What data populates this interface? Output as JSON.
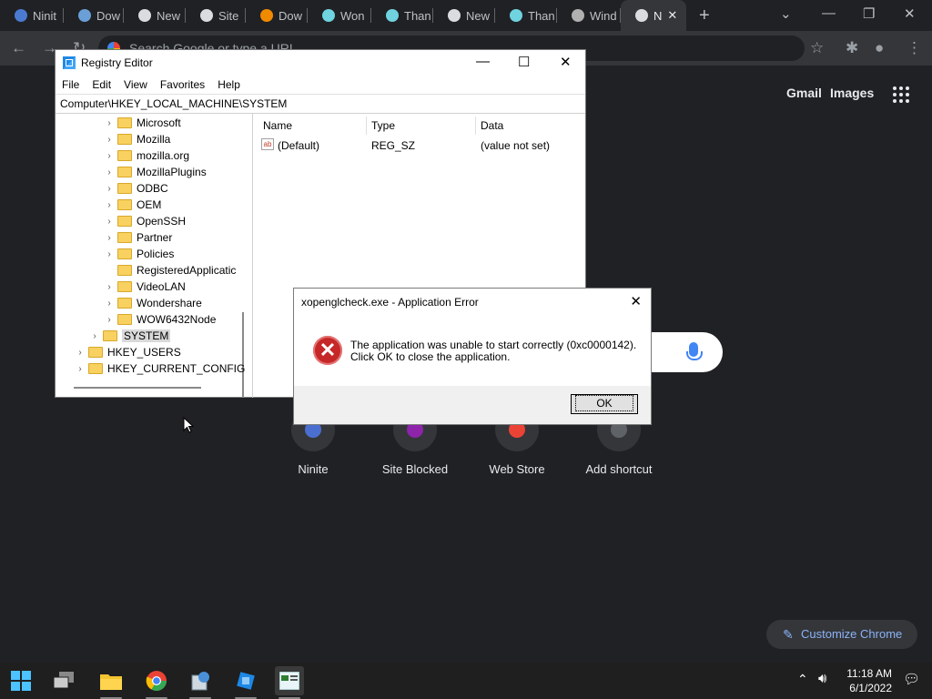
{
  "browser": {
    "tabs": [
      {
        "label": "Ninit",
        "favicon": "ninite-icon",
        "color": "#4a7bd0"
      },
      {
        "label": "Dow",
        "favicon": "download-icon",
        "color": "#6a9fd8"
      },
      {
        "label": "New",
        "favicon": "chrome-icon",
        "color": "#dadce0"
      },
      {
        "label": "Site",
        "favicon": "globe-icon",
        "color": "#dadce0"
      },
      {
        "label": "Dow",
        "favicon": "vlc-icon",
        "color": "#f08a00"
      },
      {
        "label": "Won",
        "favicon": "chevron-app-icon",
        "color": "#6fd3e0"
      },
      {
        "label": "Than",
        "favicon": "chevron-app-icon",
        "color": "#6fd3e0"
      },
      {
        "label": "New",
        "favicon": "chrome-icon",
        "color": "#dadce0"
      },
      {
        "label": "Than",
        "favicon": "chevron-app-icon",
        "color": "#6fd3e0"
      },
      {
        "label": "Wind",
        "favicon": "clapper-icon",
        "color": "#b0b0b0"
      },
      {
        "label": "N",
        "favicon": "chrome-icon",
        "color": "#dadce0",
        "active": true
      }
    ],
    "omnibox_placeholder": "Search Google or type a URL",
    "ntp": {
      "gmail": "Gmail",
      "images": "Images",
      "shortcuts": [
        {
          "label": "Ninite",
          "color": "#4a6fd0"
        },
        {
          "label": "Site Blocked",
          "color": "#8e24aa"
        },
        {
          "label": "Web Store",
          "color": "#ea4335"
        },
        {
          "label": "Add shortcut",
          "color": "#5f6368"
        }
      ],
      "customize": "Customize Chrome"
    }
  },
  "regedit": {
    "title": "Registry Editor",
    "menu": [
      "File",
      "Edit",
      "View",
      "Favorites",
      "Help"
    ],
    "address": "Computer\\HKEY_LOCAL_MACHINE\\SYSTEM",
    "tree": [
      {
        "label": "Microsoft",
        "level": 2,
        "chevron": true
      },
      {
        "label": "Mozilla",
        "level": 2,
        "chevron": true
      },
      {
        "label": "mozilla.org",
        "level": 2,
        "chevron": true
      },
      {
        "label": "MozillaPlugins",
        "level": 2,
        "chevron": true
      },
      {
        "label": "ODBC",
        "level": 2,
        "chevron": true
      },
      {
        "label": "OEM",
        "level": 2,
        "chevron": true
      },
      {
        "label": "OpenSSH",
        "level": 2,
        "chevron": true
      },
      {
        "label": "Partner",
        "level": 2,
        "chevron": true
      },
      {
        "label": "Policies",
        "level": 2,
        "chevron": true
      },
      {
        "label": "RegisteredApplicatic",
        "level": 2,
        "chevron": false
      },
      {
        "label": "VideoLAN",
        "level": 2,
        "chevron": true
      },
      {
        "label": "Wondershare",
        "level": 2,
        "chevron": true
      },
      {
        "label": "WOW6432Node",
        "level": 2,
        "chevron": true
      },
      {
        "label": "SYSTEM",
        "level": 1,
        "chevron": true,
        "selected": true
      },
      {
        "label": "HKEY_USERS",
        "level": 0,
        "chevron": true
      },
      {
        "label": "HKEY_CURRENT_CONFIG",
        "level": 0,
        "chevron": true
      }
    ],
    "columns": {
      "name": "Name",
      "type": "Type",
      "data": "Data"
    },
    "values": [
      {
        "name": "(Default)",
        "type": "REG_SZ",
        "data": "(value not set)"
      }
    ]
  },
  "dialog": {
    "title": "xopenglcheck.exe - Application Error",
    "message_line1": "The application was unable to start correctly (0xc0000142).",
    "message_line2": "Click OK to close the application.",
    "ok_label": "OK"
  },
  "taskbar": {
    "apps": [
      "start-icon",
      "task-view-icon",
      "file-explorer-icon",
      "chrome-icon",
      "setup-icon",
      "network-icon",
      "regedit-icon"
    ],
    "time": "11:18 AM",
    "date": "6/1/2022"
  }
}
